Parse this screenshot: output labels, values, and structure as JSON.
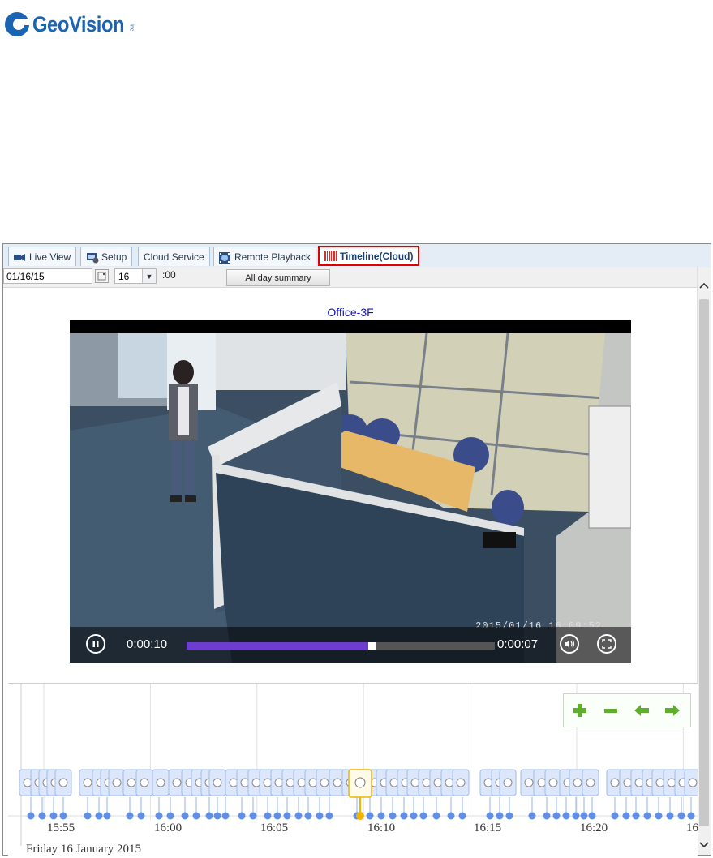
{
  "brand": {
    "name": "GeoVision",
    "suffix": "Inc."
  },
  "tabs": [
    {
      "label": "Live View",
      "icon": "camera-icon"
    },
    {
      "label": "Setup",
      "icon": "setup-icon"
    },
    {
      "label": "Cloud Service",
      "icon": ""
    },
    {
      "label": "Remote Playback",
      "icon": "playback-icon"
    },
    {
      "label": "Timeline(Cloud)",
      "icon": "timeline-icon",
      "active": true
    }
  ],
  "toolbar": {
    "date": "01/16/15",
    "hour": "16",
    "minutes": ":00",
    "summary_label": "All day summary"
  },
  "camera": {
    "name": "Office-3F",
    "osd_timestamp": "2015/01/16   16:09:52"
  },
  "player": {
    "elapsed": "0:00:10",
    "remaining": "0:00:07",
    "progress": 0.6
  },
  "timeline": {
    "ticks": [
      "15:55",
      "16:00",
      "16:05",
      "16:10",
      "16:15",
      "16:20",
      "16"
    ],
    "date": "Friday 16 January 2015"
  },
  "colors": {
    "accent": "#1a64b4",
    "progress": "#6e3ccf",
    "clip": "#7fa8f0",
    "selected": "#f0b400",
    "active_border": "#e00000"
  }
}
